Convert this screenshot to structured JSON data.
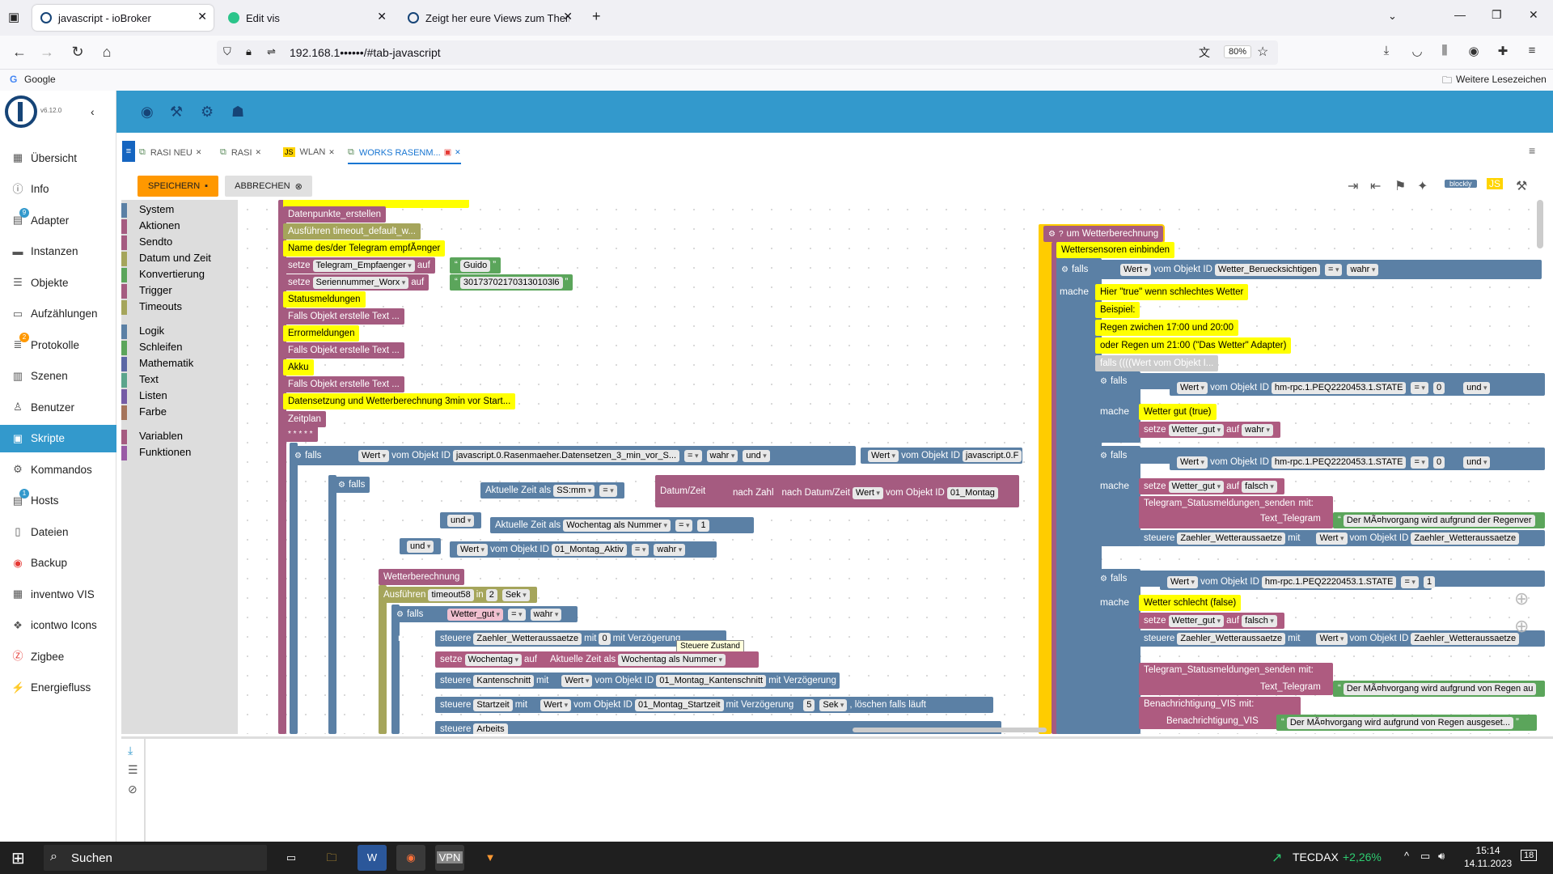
{
  "browser": {
    "tabs": [
      {
        "title": "javascript - ioBroker",
        "active": true
      },
      {
        "title": "Edit vis",
        "active": false
      },
      {
        "title": "Zeigt her eure Views zum Them",
        "active": false
      }
    ],
    "url": "192.168.1••••••/#tab-javascript",
    "zoom": "80%",
    "bookmark_left": "Google",
    "bookmark_right": "Weitere Lesezeichen"
  },
  "iobroker": {
    "version": "v6.12.0",
    "menu": [
      {
        "label": "Übersicht",
        "icon": "grid-icon"
      },
      {
        "label": "Info",
        "icon": "info-icon"
      },
      {
        "label": "Adapter",
        "icon": "store-icon",
        "badge": "9"
      },
      {
        "label": "Instanzen",
        "icon": "instances-icon"
      },
      {
        "label": "Objekte",
        "icon": "list-icon"
      },
      {
        "label": "Aufzählungen",
        "icon": "enum-icon"
      },
      {
        "label": "Protokolle",
        "icon": "log-icon",
        "badge": "2"
      },
      {
        "label": "Szenen",
        "icon": "scene-icon"
      },
      {
        "label": "Benutzer",
        "icon": "user-icon"
      },
      {
        "label": "Skripte",
        "icon": "script-icon",
        "active": true
      },
      {
        "label": "Kommandos",
        "icon": "command-icon"
      },
      {
        "label": "Hosts",
        "icon": "host-icon",
        "badge": "1"
      },
      {
        "label": "Dateien",
        "icon": "file-icon"
      },
      {
        "label": "Backup",
        "icon": "backup-icon"
      },
      {
        "label": "inventwo VIS",
        "icon": "vis-icon"
      },
      {
        "label": "icontwo Icons",
        "icon": "icons-icon"
      },
      {
        "label": "Zigbee",
        "icon": "zigbee-icon"
      },
      {
        "label": "Energiefluss",
        "icon": "energy-icon"
      }
    ],
    "script_tabs": [
      {
        "label": "RASI NEU"
      },
      {
        "label": "RASI"
      },
      {
        "label": "WLAN"
      },
      {
        "label": "WORKS RASENM...",
        "active": true
      }
    ],
    "save_label": "SPEICHERN",
    "cancel_label": "ABBRECHEN",
    "mode_label": "blockly",
    "toolbox": [
      {
        "label": "System",
        "color": "#5b80a5"
      },
      {
        "label": "Aktionen",
        "color": "#a55b80"
      },
      {
        "label": "Sendto",
        "color": "#a55b80"
      },
      {
        "label": "Datum und Zeit",
        "color": "#a5a55b"
      },
      {
        "label": "Konvertierung",
        "color": "#5ba55b"
      },
      {
        "label": "Trigger",
        "color": "#a55b80"
      },
      {
        "label": "Timeouts",
        "color": "#a5a55b"
      },
      {
        "label": "Logik",
        "color": "#5b80a5"
      },
      {
        "label": "Schleifen",
        "color": "#5ba55b"
      },
      {
        "label": "Mathematik",
        "color": "#5b67a5"
      },
      {
        "label": "Text",
        "color": "#5ba58c"
      },
      {
        "label": "Listen",
        "color": "#745ba5"
      },
      {
        "label": "Farbe",
        "color": "#a5745b"
      },
      {
        "label": "Variablen",
        "color": "#a55b80"
      },
      {
        "label": "Funktionen",
        "color": "#995ba5"
      }
    ],
    "tooltip": "Steuere Zustand"
  },
  "blocks_left": {
    "b0": "Datenpunkte_erstellen",
    "b1": "Ausführen timeout_default_w...",
    "b2": "Name des/der Telegram empfÃ¤nger",
    "set": "setze",
    "to": "auf",
    "var1": "Telegram_Empfaenger",
    "val1": "Guido",
    "var2": "Seriennummer_Worx",
    "val2": "301737021703130103l6",
    "b3": "Statusmeldungen",
    "b4": "Falls Objekt erstelle Text ...",
    "b5": "Errormeldungen",
    "b6": "Falls Objekt erstelle Text ...",
    "b7": "Akku",
    "b8": "Falls Objekt erstelle Text ...",
    "b9": "Datensetzung und Wetterberechnung 3min vor Start...",
    "b10": "Zeitplan",
    "b11": "* * * * *",
    "if": "falls",
    "do": "mache",
    "and": "und",
    "true": "wahr",
    "eq": "=",
    "wert": "Wert",
    "vomObj": "vom Objekt ID",
    "obj1": "javascript.0.Rasenmaeher.Datensetzen_3_min_vor_S...",
    "obj1b": "javascript.0.F",
    "akt_zeit": "Aktuelle Zeit als",
    "ssmm": "SS:mm",
    "datumzeit": "Datum/Zeit",
    "nachzahl": "nach Zahl",
    "nachdatum": "nach Datum/Zeit",
    "obj2": "01_Montag",
    "wochentag_nr": "Wochentag als Nummer",
    "one": "1",
    "obj3": "01_Montag_Aktiv",
    "wetterberechnung": "Wetterberechnung",
    "ausfuehren": "Ausführen",
    "timeout58": "timeout58",
    "in": "in",
    "two": "2",
    "sek": "Sek",
    "wetter_gut": "Wetter_gut",
    "steuere": "steuere",
    "mit": "mit",
    "zaehler": "Zaehler_Wetteraussaetze",
    "zero": "0",
    "mitverz": "mit Verzögerung",
    "wochentag": "Wochentag",
    "wochentag_als": "Wochentag als Nummer",
    "kantenschnitt": "Kantenschnitt",
    "obj4": "01_Montag_Kantenschnitt",
    "startzeit": "Startzeit",
    "obj5": "01_Montag_Startzeit",
    "five": "5",
    "loeschen": ", löschen falls läuft",
    "arbeits": "Arbeits"
  },
  "blocks_right": {
    "func": "um Wetterberechnung",
    "comment": "Wettersensoren einbinden",
    "if": "falls",
    "do": "mache",
    "true": "wahr",
    "false": "falsch",
    "eq": "=",
    "and": "und",
    "wert": "Wert",
    "vomObj": "vom Objekt ID",
    "obj0": "Wetter_Beruecksichtigen",
    "c1": "Hier \"true\" wenn schlechtes Wetter",
    "c2": "Beispiel:",
    "c3": "Regen zwichen 17:00 und 20:00",
    "c4": "oder Regen um 21:00 (\"Das Wetter\" Adapter)",
    "disabled": "falls ((((Wert vom Objekt I...",
    "hmobj": "hm-rpc.1.PEQ2220453.1.STATE",
    "zero": "0",
    "one": "1",
    "c5": "Wetter gut (true)",
    "set": "setze",
    "to": "auf",
    "var": "Wetter_gut",
    "tg": "Telegram_Statusmeldungen_senden",
    "mit": "mit:",
    "text_tg": "Text_Telegram",
    "msg1": "Der MÃ¤hvorgang wird aufgrund der Regenver",
    "steuere": "steuere",
    "zaehler": "Zaehler_Wetteraussaetze",
    "mit2": "mit",
    "c6": "Wetter schlecht (false)",
    "msg2": "Der MÃ¤hvorgang wird aufgrund von Regen au",
    "vis": "Benachrichtigung_VIS",
    "msg3": "Der MÃ¤hvorgang wird aufgrund von Regen ausgeset..."
  },
  "taskbar": {
    "search": "Suchen",
    "ticker": "TECDAX",
    "ticker_change": "+2,26%",
    "time": "15:14",
    "date": "14.11.2023",
    "notif": "18",
    "vpn": "VPN"
  }
}
